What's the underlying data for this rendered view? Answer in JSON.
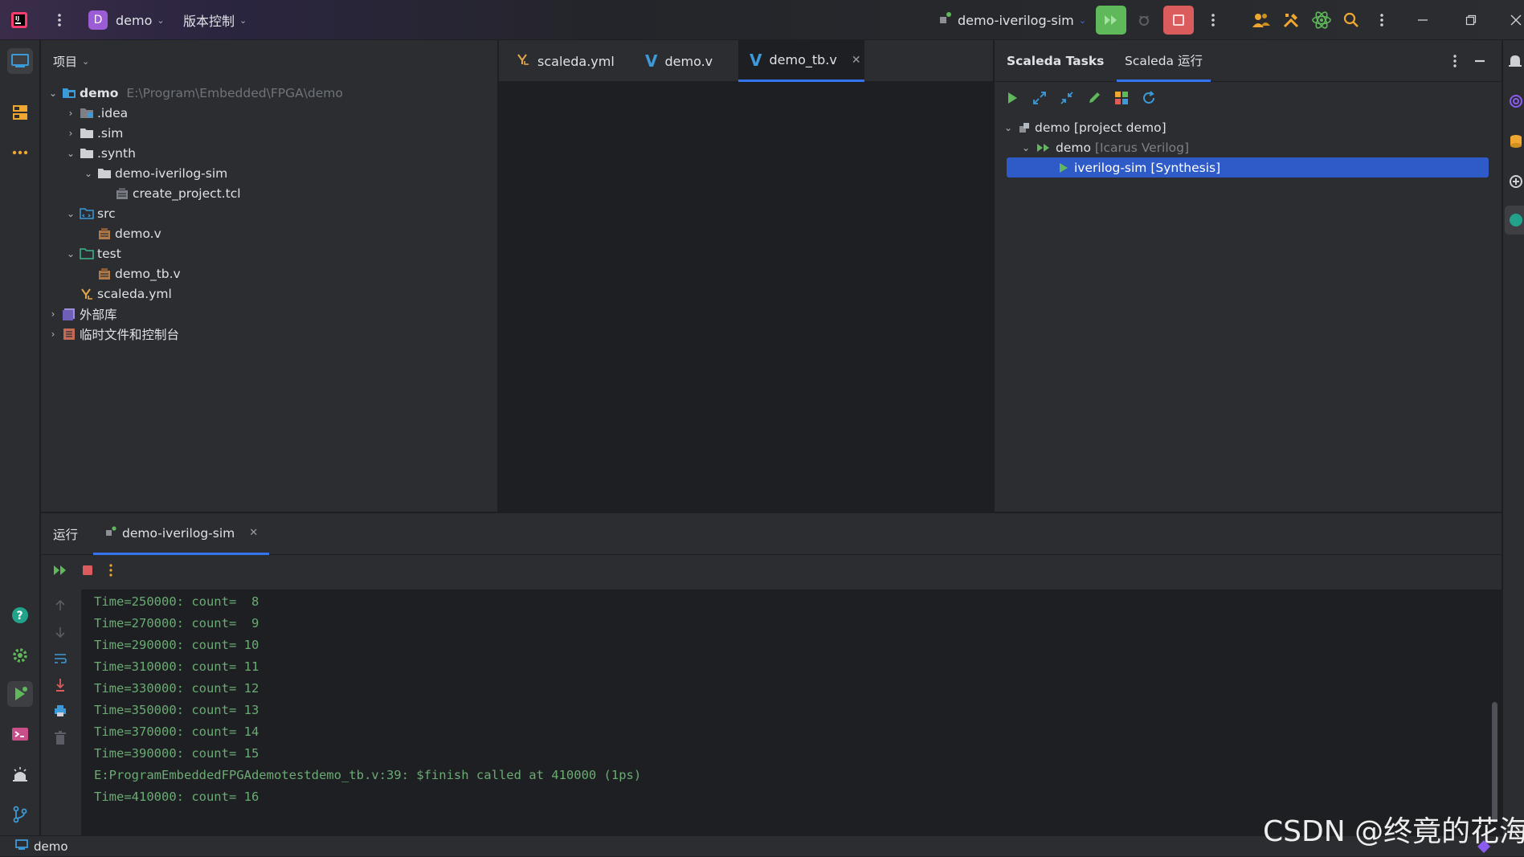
{
  "titlebar": {
    "project_badge": "D",
    "project_name": "demo",
    "vcs_label": "版本控制",
    "run_config": "demo-iverilog-sim"
  },
  "project_panel": {
    "title": "项目",
    "tree": [
      {
        "label": "demo",
        "path": "E:\\Program\\Embedded\\FPGA\\demo",
        "bold": true
      },
      {
        "label": ".idea"
      },
      {
        "label": ".sim"
      },
      {
        "label": ".synth"
      },
      {
        "label": "demo-iverilog-sim"
      },
      {
        "label": "create_project.tcl"
      },
      {
        "label": "src"
      },
      {
        "label": "demo.v"
      },
      {
        "label": "test"
      },
      {
        "label": "demo_tb.v"
      },
      {
        "label": "scaleda.yml"
      },
      {
        "label": "外部库"
      },
      {
        "label": "临时文件和控制台"
      }
    ]
  },
  "editor": {
    "tabs": [
      {
        "label": "scaleda.yml"
      },
      {
        "label": "demo.v"
      },
      {
        "label": "demo_tb.v",
        "active": true
      }
    ]
  },
  "scaleda": {
    "tabs": [
      "Scaleda Tasks",
      "Scaleda 运行"
    ],
    "tree": [
      {
        "label": "demo",
        "suffix": "[project demo]"
      },
      {
        "label": "demo",
        "suffix": "[Icarus Verilog]"
      },
      {
        "label": "iverilog-sim [Synthesis]",
        "selected": true
      }
    ]
  },
  "run_panel": {
    "title": "运行",
    "tab_label": "demo-iverilog-sim",
    "lines": [
      "Time=250000: count=  8",
      "Time=270000: count=  9",
      "Time=290000: count= 10",
      "Time=310000: count= 11",
      "Time=330000: count= 12",
      "Time=350000: count= 13",
      "Time=370000: count= 14",
      "Time=390000: count= 15",
      "E:ProgramEmbeddedFPGAdemotestdemo_tb.v:39: $finish called at 410000 (1ps)",
      "Time=410000: count= 16"
    ]
  },
  "statusbar": {
    "project": "demo"
  },
  "watermark": "CSDN @终竟的花海",
  "colors": {
    "accent": "#3574f0",
    "run_green": "#5fb85a",
    "stop_red": "#db5c5c",
    "console_text": "#6aab73"
  }
}
